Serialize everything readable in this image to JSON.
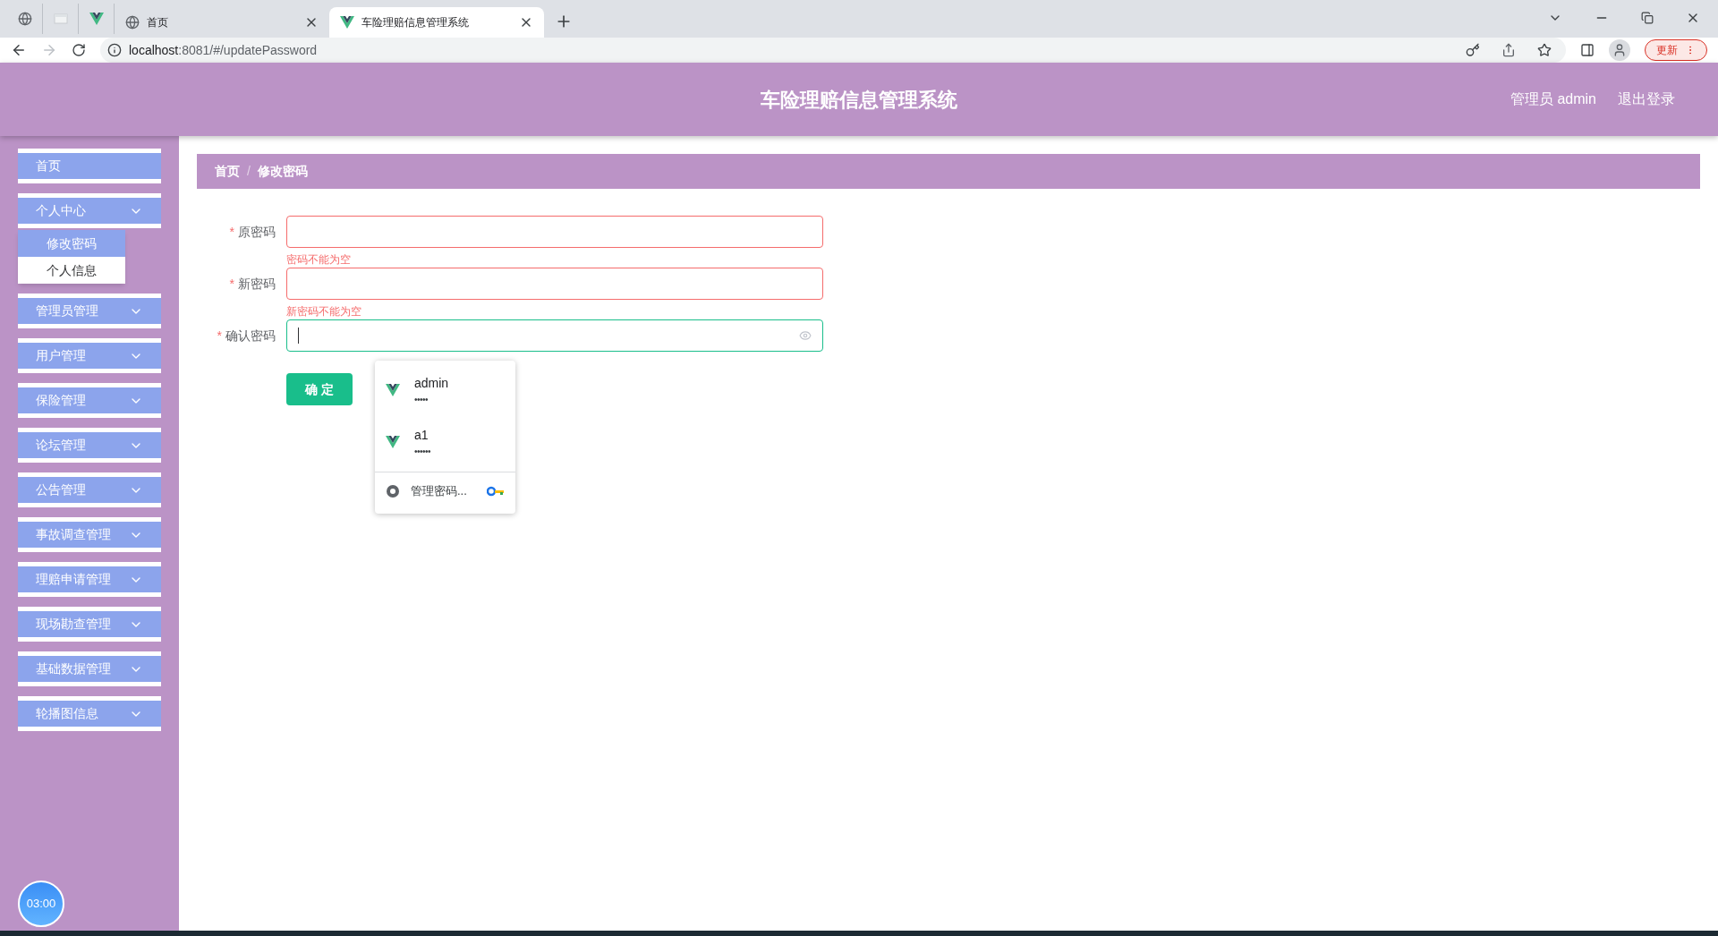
{
  "browser": {
    "tabs": [
      {
        "kind": "pinned",
        "selected": false
      },
      {
        "kind": "pinned",
        "selected": false
      },
      {
        "kind": "pinned",
        "selected": false
      },
      {
        "kind": "full",
        "title": "首页",
        "selected": false
      },
      {
        "kind": "full",
        "title": "车险理赔信息管理系统",
        "selected": true
      }
    ],
    "url_host": "localhost",
    "url_path": ":8081/#/updatePassword",
    "update_button": "更新"
  },
  "header": {
    "title": "车险理赔信息管理系统",
    "user": "管理员 admin",
    "logout": "退出登录"
  },
  "sidebar": {
    "items": [
      {
        "label": "首页",
        "kind": "link"
      },
      {
        "label": "个人中心",
        "kind": "submenu",
        "children": [
          {
            "label": "修改密码",
            "selected": true
          },
          {
            "label": "个人信息",
            "selected": false
          }
        ]
      },
      {
        "label": "管理员管理",
        "kind": "submenu"
      },
      {
        "label": "用户管理",
        "kind": "submenu"
      },
      {
        "label": "保险管理",
        "kind": "submenu"
      },
      {
        "label": "论坛管理",
        "kind": "submenu"
      },
      {
        "label": "公告管理",
        "kind": "submenu"
      },
      {
        "label": "事故调查管理",
        "kind": "submenu"
      },
      {
        "label": "理赔申请管理",
        "kind": "submenu"
      },
      {
        "label": "现场勘查管理",
        "kind": "submenu"
      },
      {
        "label": "基础数据管理",
        "kind": "submenu"
      },
      {
        "label": "轮播图信息",
        "kind": "submenu"
      }
    ],
    "timer": "03:00"
  },
  "breadcrumb": {
    "items": [
      "首页",
      "修改密码"
    ],
    "separator": "/"
  },
  "form": {
    "fields": [
      {
        "label": "原密码",
        "required_mark": "*",
        "focused": false,
        "error": "密码不能为空"
      },
      {
        "label": "新密码",
        "required_mark": "*",
        "focused": false,
        "error": "新密码不能为空"
      },
      {
        "label": "确认密码",
        "required_mark": "*",
        "focused": true
      }
    ],
    "submit": "确 定"
  },
  "autofill": {
    "entries": [
      {
        "username": "admin",
        "password": "•••••"
      },
      {
        "username": "a1",
        "password": "••••••"
      }
    ],
    "manage": "管理密码..."
  }
}
